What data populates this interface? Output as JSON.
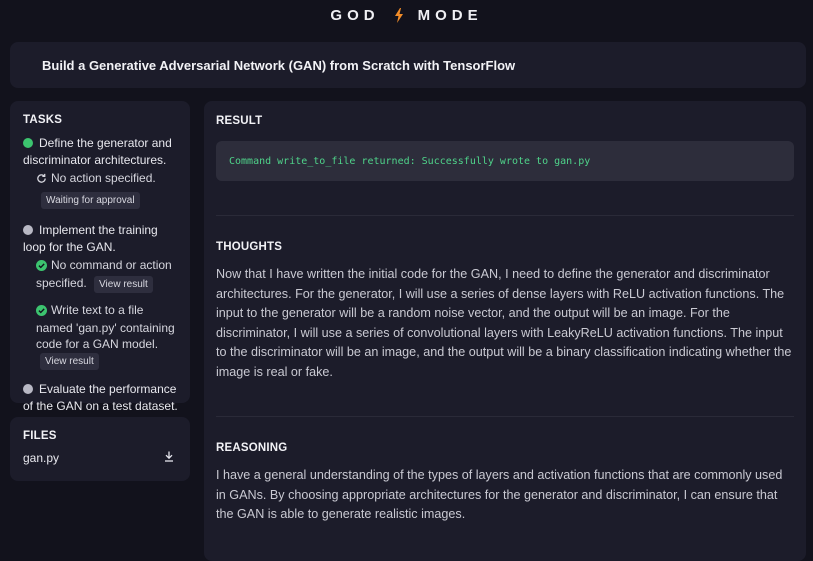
{
  "header": {
    "left_word": "GOD",
    "right_word": "MODE",
    "icon": "lightning-bolt-icon",
    "accent": "#f28c28"
  },
  "goal": {
    "text": "Build a Generative Adversarial Network (GAN) from Scratch with TensorFlow"
  },
  "tasks": {
    "title": "TASKS",
    "items": [
      {
        "status": "done",
        "label": "Define the generator and discriminator architectures.",
        "subitems": [
          {
            "icon": "refresh-icon",
            "text": "No action specified.",
            "badge": "Waiting for approval"
          }
        ]
      },
      {
        "status": "pending",
        "label": "Implement the training loop for the GAN.",
        "subitems": [
          {
            "icon": "check-circle-icon",
            "text": "No command or action specified.",
            "badge": "View result"
          },
          {
            "icon": "check-circle-icon",
            "text": "Write text to a file named 'gan.py' containing code for a GAN model.",
            "badge": "View result"
          }
        ]
      },
      {
        "status": "pending",
        "label": "Evaluate the performance of the GAN on a test dataset.",
        "subitems": []
      }
    ]
  },
  "files": {
    "title": "FILES",
    "items": [
      {
        "name": "gan.py",
        "icon": "download-icon"
      }
    ]
  },
  "result": {
    "title": "RESULT",
    "output": "Command write_to_file returned: Successfully wrote to gan.py"
  },
  "thoughts": {
    "title": "THOUGHTS",
    "text": "Now that I have written the initial code for the GAN, I need to define the generator and discriminator architectures. For the generator, I will use a series of dense layers with ReLU activation functions. The input to the generator will be a random noise vector, and the output will be an image. For the discriminator, I will use a series of convolutional layers with LeakyReLU activation functions. The input to the discriminator will be an image, and the output will be a binary classification indicating whether the image is real or fake."
  },
  "reasoning": {
    "title": "REASONING",
    "text": "I have a general understanding of the types of layers and activation functions that are commonly used in GANs. By choosing appropriate architectures for the generator and discriminator, I can ensure that the GAN is able to generate realistic images."
  },
  "colors": {
    "background": "#12121c",
    "panel": "#1c1c2a",
    "success": "#3cc46f",
    "code_text": "#4fd38a"
  }
}
